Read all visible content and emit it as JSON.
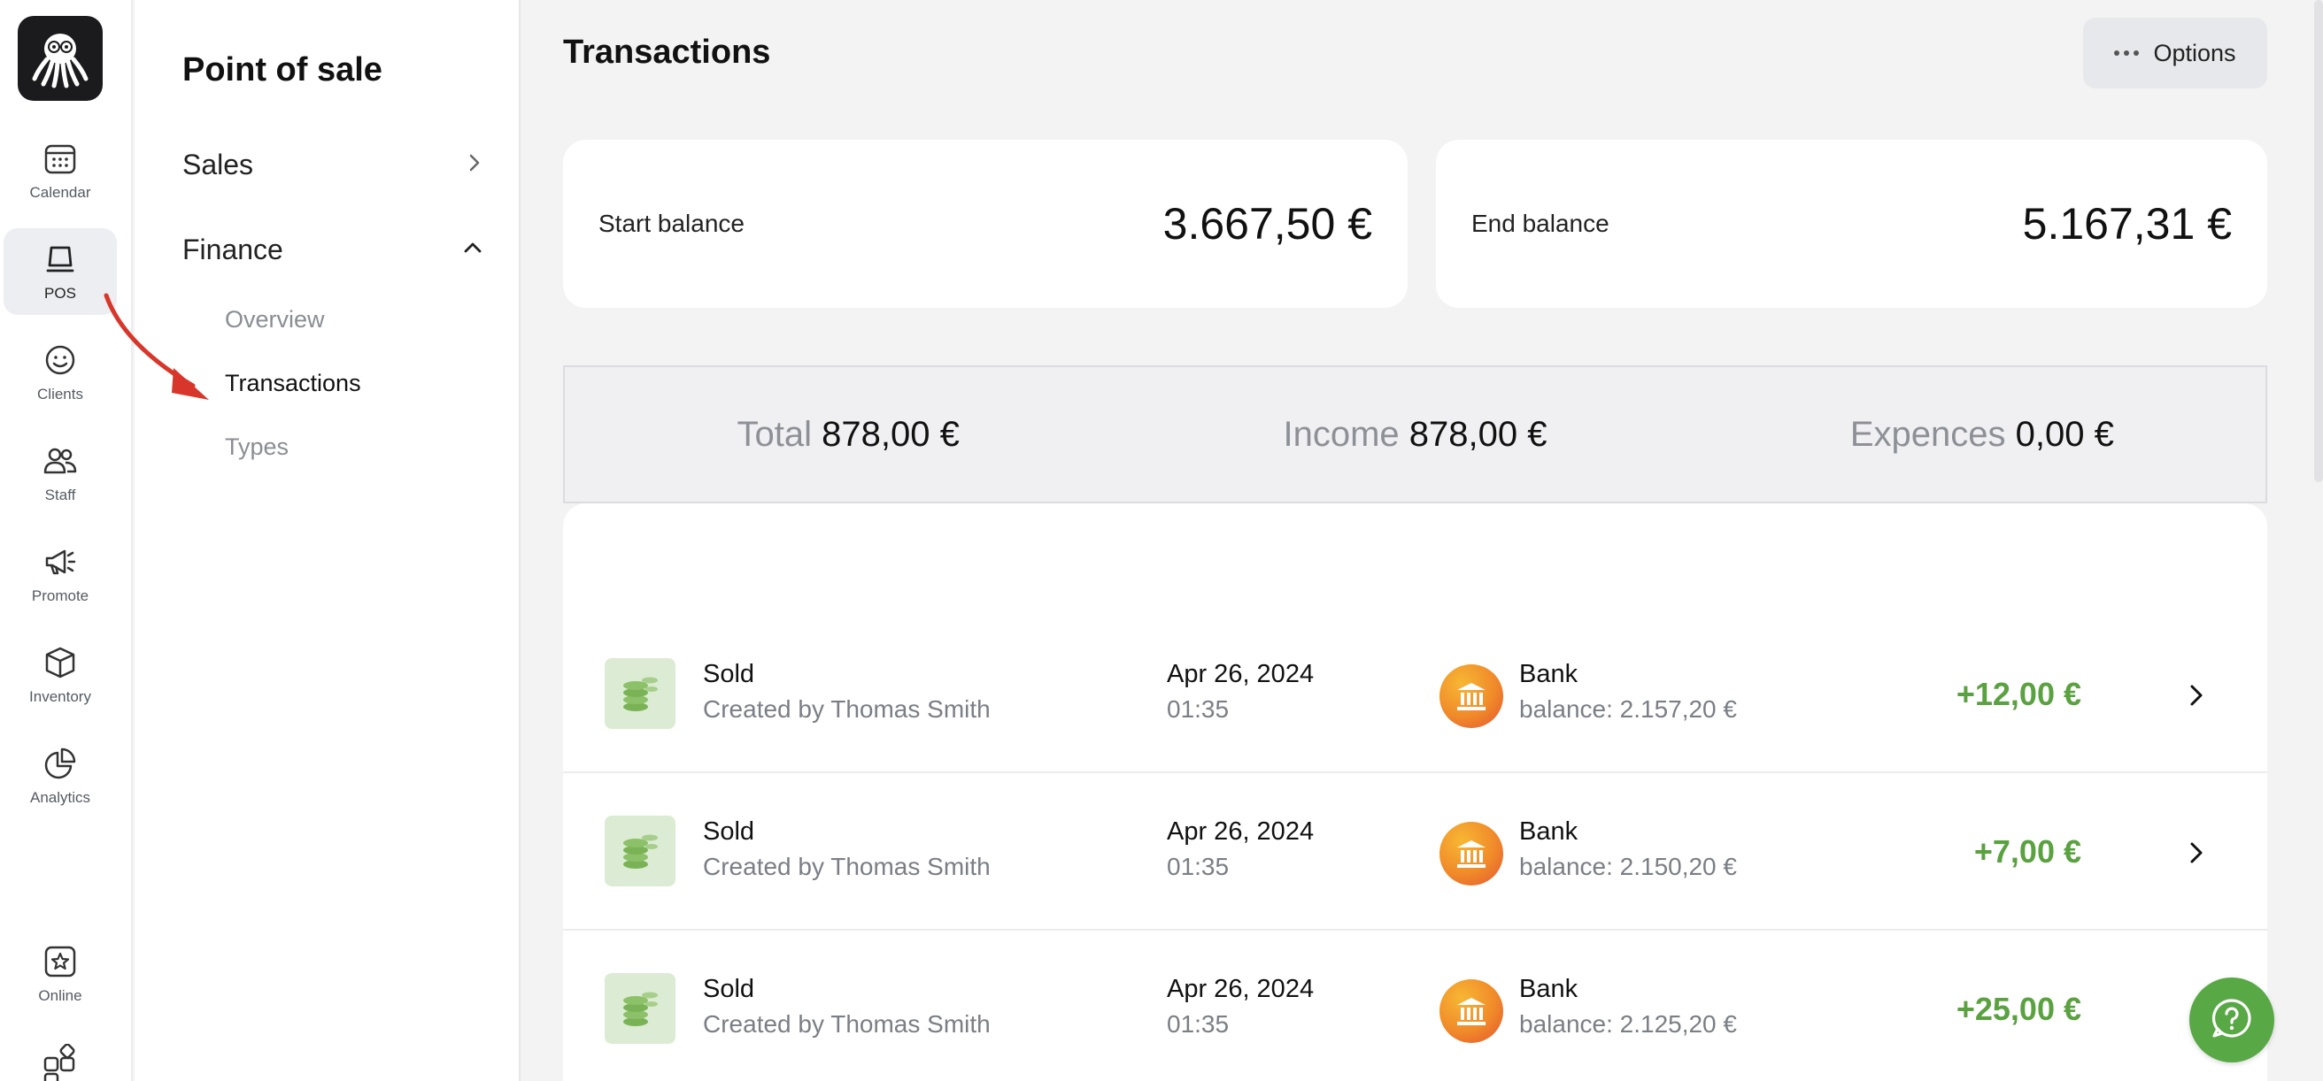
{
  "rail": {
    "items": [
      {
        "label": "Calendar",
        "icon": "calendar-icon"
      },
      {
        "label": "POS",
        "icon": "pos-icon",
        "active": true
      },
      {
        "label": "Clients",
        "icon": "smiley-icon"
      },
      {
        "label": "Staff",
        "icon": "people-icon"
      },
      {
        "label": "Promote",
        "icon": "megaphone-icon"
      },
      {
        "label": "Inventory",
        "icon": "box-icon"
      },
      {
        "label": "Analytics",
        "icon": "pie-chart-icon"
      },
      {
        "label": "Online",
        "icon": "star-icon"
      }
    ]
  },
  "subnav": {
    "title": "Point of sale",
    "groups": [
      {
        "label": "Sales",
        "expanded": false
      },
      {
        "label": "Finance",
        "expanded": true
      }
    ],
    "finance_items": [
      "Overview",
      "Transactions",
      "Types"
    ],
    "active_item": "Transactions"
  },
  "main": {
    "title": "Transactions",
    "options_label": "Options",
    "start_balance": {
      "label": "Start balance",
      "value": "3.667,50 €"
    },
    "end_balance": {
      "label": "End balance",
      "value": "5.167,31 €"
    },
    "summary": {
      "total_label": "Total",
      "total_value": "878,00 €",
      "income_label": "Income",
      "income_value": "878,00 €",
      "expenses_label": "Expences",
      "expenses_value": "0,00 €"
    },
    "transactions": [
      {
        "type": "Sold",
        "creator": "Created by Thomas Smith",
        "date": "Apr 26, 2024",
        "time": "01:35",
        "account": "Bank",
        "balance": "balance: 2.157,20 €",
        "amount": "+12,00 €"
      },
      {
        "type": "Sold",
        "creator": "Created by Thomas Smith",
        "date": "Apr 26, 2024",
        "time": "01:35",
        "account": "Bank",
        "balance": "balance: 2.150,20 €",
        "amount": "+7,00 €"
      },
      {
        "type": "Sold",
        "creator": "Created by Thomas Smith",
        "date": "Apr 26, 2024",
        "time": "01:35",
        "account": "Bank",
        "balance": "balance: 2.125,20 €",
        "amount": "+25,00 €"
      }
    ]
  },
  "colors": {
    "accent_green": "#5aa140",
    "help_green": "#58a845",
    "annotation_red": "#d8362a"
  }
}
